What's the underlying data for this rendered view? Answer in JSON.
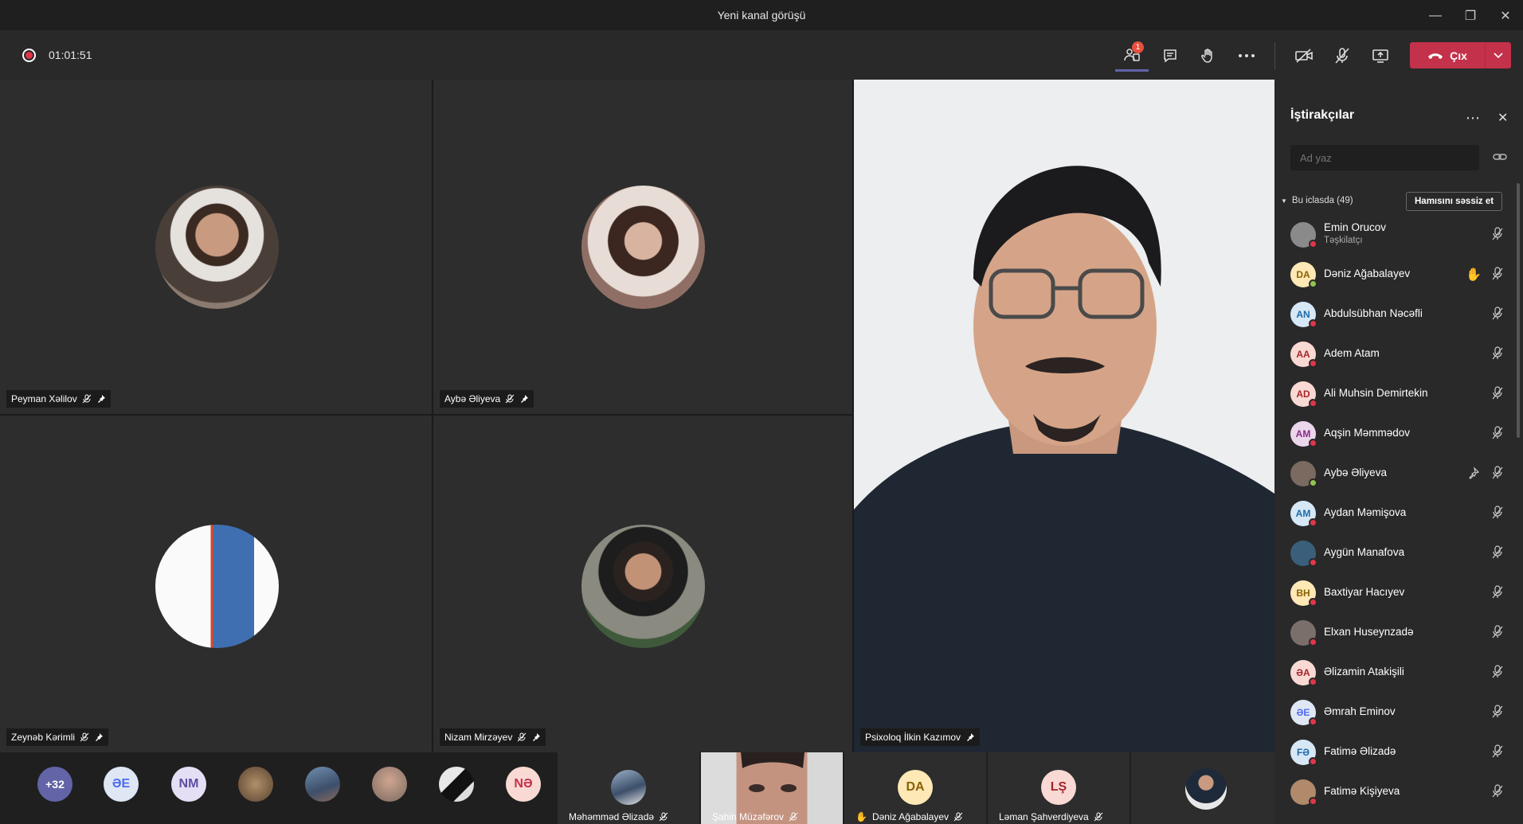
{
  "window": {
    "title": "Yeni kanal görüşü",
    "controls": [
      "minimize",
      "restore",
      "close"
    ]
  },
  "toolbar": {
    "recording_time": "01:01:51",
    "participants_badge": "1",
    "leave_label": "Çıx"
  },
  "grid": {
    "tiles": [
      {
        "name": "Peyman Xəlilov"
      },
      {
        "name": "Aybə Əliyeva"
      },
      {
        "name": "Zeynəb Kərimli"
      },
      {
        "name": "Nizam Mirzəyev"
      }
    ],
    "speaker": {
      "name": "Psixoloq İlkin Kazımov"
    }
  },
  "strip": {
    "overflow": "+32",
    "avatars": [
      {
        "initials": "ƏE",
        "color": "#dfe7f5",
        "text_color": "#4f6bed"
      },
      {
        "initials": "NM",
        "color": "#e5dff5",
        "text_color": "#5b4fa0"
      },
      {
        "initials": "NƏ",
        "color": "#f9d9d3",
        "text_color": "#c4314b"
      }
    ],
    "tiles": [
      {
        "name": "Məhəmməd Əlizadə"
      },
      {
        "name": "Şahin Müzəfərov"
      },
      {
        "name": "Dəniz Ağabalayev",
        "initials": "DA"
      },
      {
        "name": "Ləman Şahverdiyeva",
        "initials": "LŞ"
      }
    ]
  },
  "panel": {
    "title": "İştirakçılar",
    "search_placeholder": "Ad yaz",
    "section_label": "Bu iclasda (49)",
    "mute_all_label": "Hamısını səssiz et",
    "participants": [
      {
        "name": "Emin Orucov",
        "role": "Təşkilatçı",
        "initials": "",
        "color": "#8a8a8a",
        "status": "red"
      },
      {
        "name": "Dəniz Ağabalayev",
        "initials": "DA",
        "color": "#fde8b6",
        "text_color": "#8a6100",
        "status": "green",
        "hand": true
      },
      {
        "name": "Abdulsübhan Nəcəfli",
        "initials": "AN",
        "color": "#d6e7f5",
        "text_color": "#1c6aa8",
        "status": "red"
      },
      {
        "name": "Adem Atam",
        "initials": "AA",
        "color": "#f9d9d3",
        "text_color": "#a4262c",
        "status": "red"
      },
      {
        "name": "Ali Muhsin Demirtekin",
        "initials": "AD",
        "color": "#f9d9d3",
        "text_color": "#a4262c",
        "status": "red"
      },
      {
        "name": "Aqşin Məmmədov",
        "initials": "AM",
        "color": "#ecd6ec",
        "text_color": "#8a2b8a",
        "status": "red"
      },
      {
        "name": "Aybə Əliyeva",
        "initials": "",
        "color": "#7a6a60",
        "status": "green",
        "pin": true
      },
      {
        "name": "Aydan Məmişova",
        "initials": "AM",
        "color": "#d6e7f5",
        "text_color": "#1c6aa8",
        "status": "red"
      },
      {
        "name": "Aygün Manafova",
        "initials": "",
        "color": "#3a5f7a",
        "status": "red"
      },
      {
        "name": "Baxtiyar Hacıyev",
        "initials": "BH",
        "color": "#fde8b6",
        "text_color": "#8a6100",
        "status": "red"
      },
      {
        "name": "Elxan Huseynzadə",
        "initials": "",
        "color": "#7a6f6a",
        "status": "red"
      },
      {
        "name": "Əlizamin Atakişili",
        "initials": "ƏA",
        "color": "#f9d9d3",
        "text_color": "#a4262c",
        "status": "red"
      },
      {
        "name": "Əmrah Eminov",
        "initials": "ƏE",
        "color": "#dfe7f5",
        "text_color": "#4f6bed",
        "status": "red"
      },
      {
        "name": "Fatimə Əlizadə",
        "initials": "FƏ",
        "color": "#d6e7f5",
        "text_color": "#1c6aa8",
        "status": "red"
      },
      {
        "name": "Fatimə Kişiyeva",
        "initials": "",
        "color": "#b08a6a",
        "status": "red"
      }
    ]
  }
}
